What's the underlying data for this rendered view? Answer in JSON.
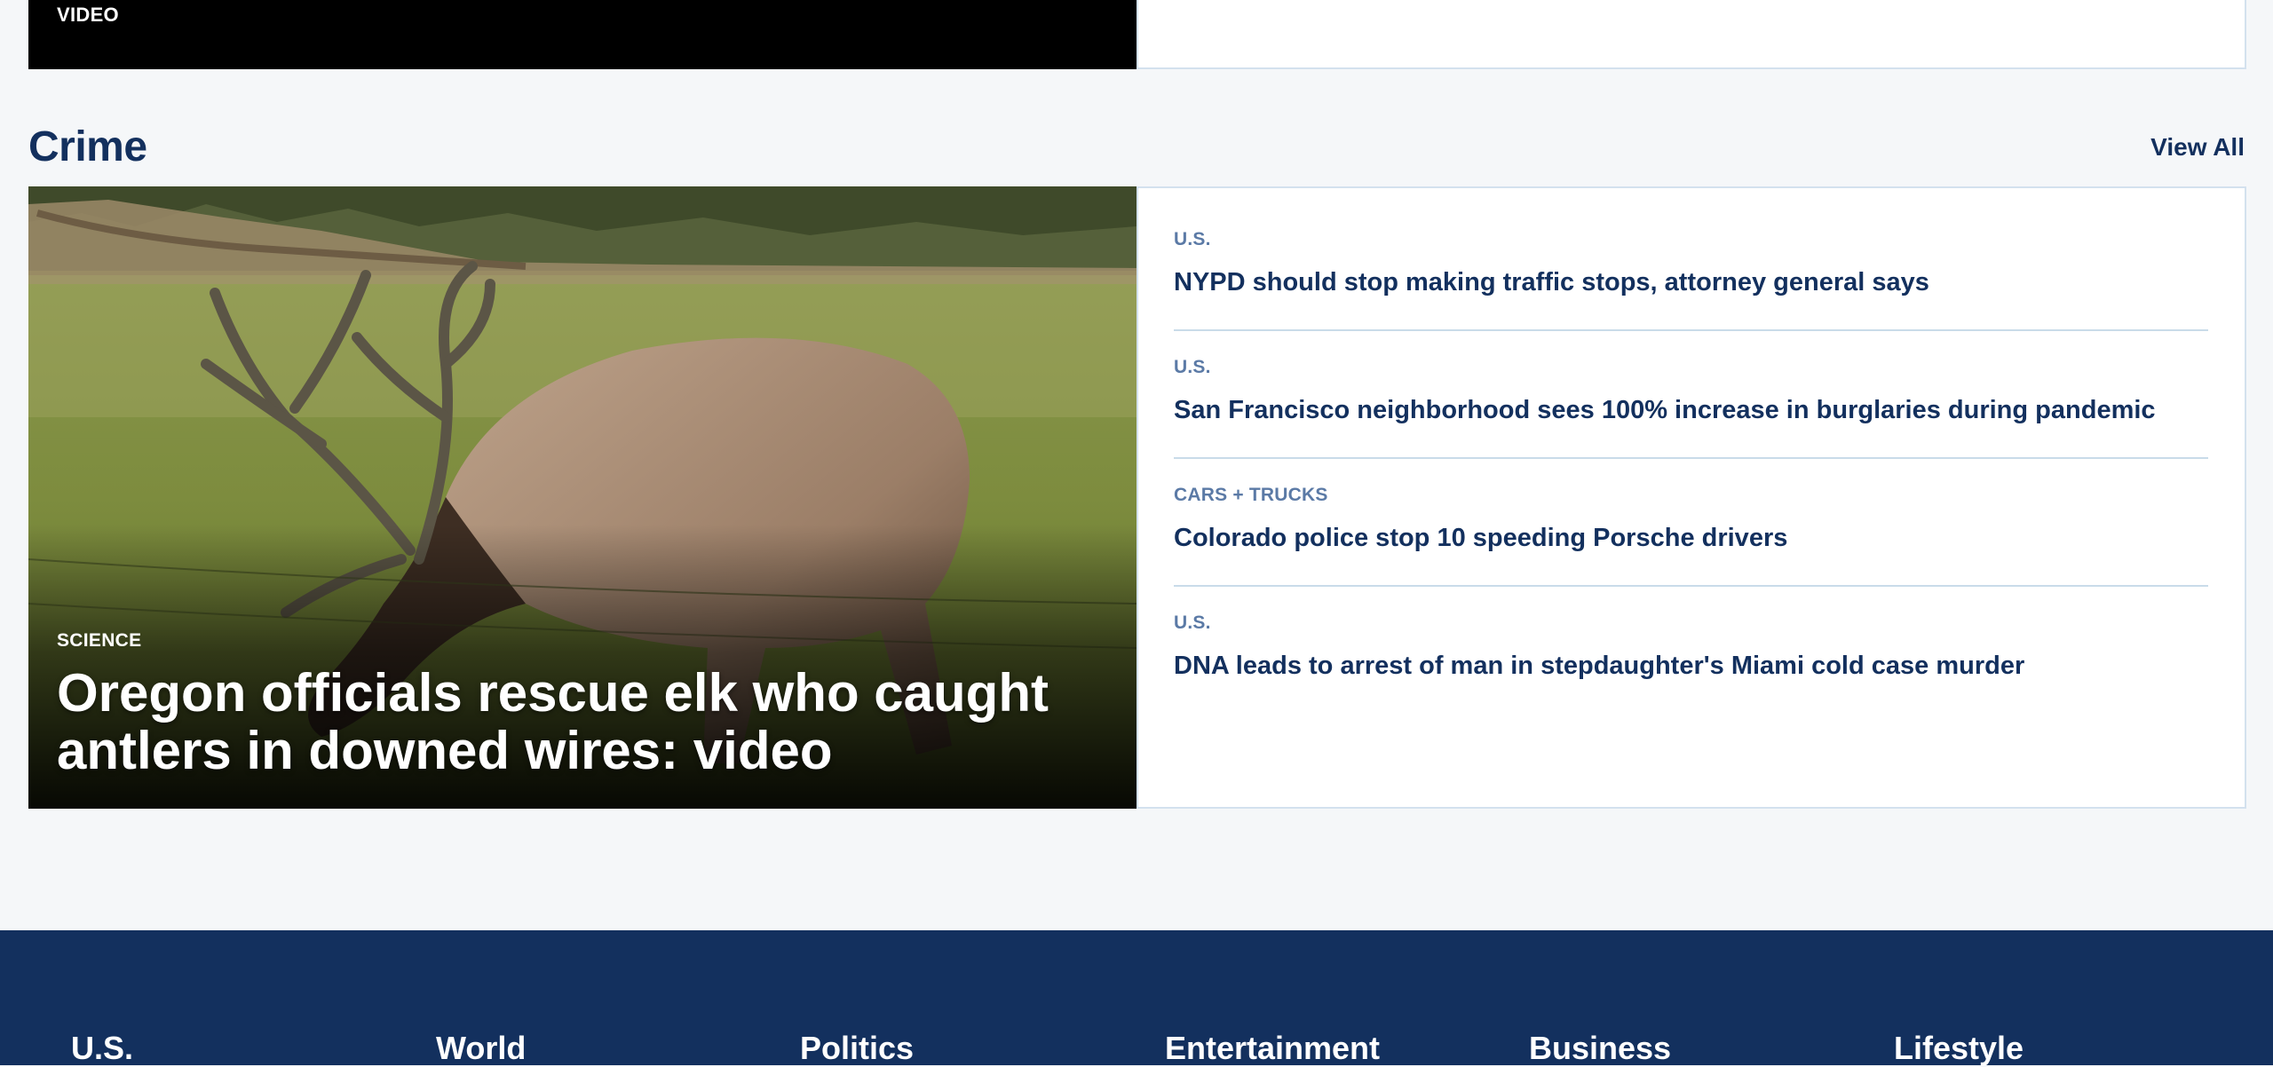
{
  "top_section": {
    "media_label": "VIDEO"
  },
  "section": {
    "title": "Crime",
    "view_all_label": "View All"
  },
  "feature": {
    "category": "SCIENCE",
    "headline": "Oregon officials rescue elk who caught antlers in downed wires: video"
  },
  "stories": [
    {
      "category": "U.S.",
      "title": "NYPD should stop making traffic stops, attorney general says"
    },
    {
      "category": "U.S.",
      "title": "San Francisco neighborhood sees 100% increase in burglaries during pandemic"
    },
    {
      "category": "CARS + TRUCKS",
      "title": "Colorado police stop 10 speeding Porsche drivers"
    },
    {
      "category": "U.S.",
      "title": "DNA leads to arrest of man in stepdaughter's Miami cold case murder"
    }
  ],
  "footer": {
    "columns": [
      "U.S.",
      "World",
      "Politics",
      "Entertainment",
      "Business",
      "Lifestyle"
    ]
  },
  "colors": {
    "brand_navy": "#13305e",
    "category_blue": "#5b7aa6",
    "page_background": "#f5f7f9",
    "border": "#d3e1ee"
  }
}
